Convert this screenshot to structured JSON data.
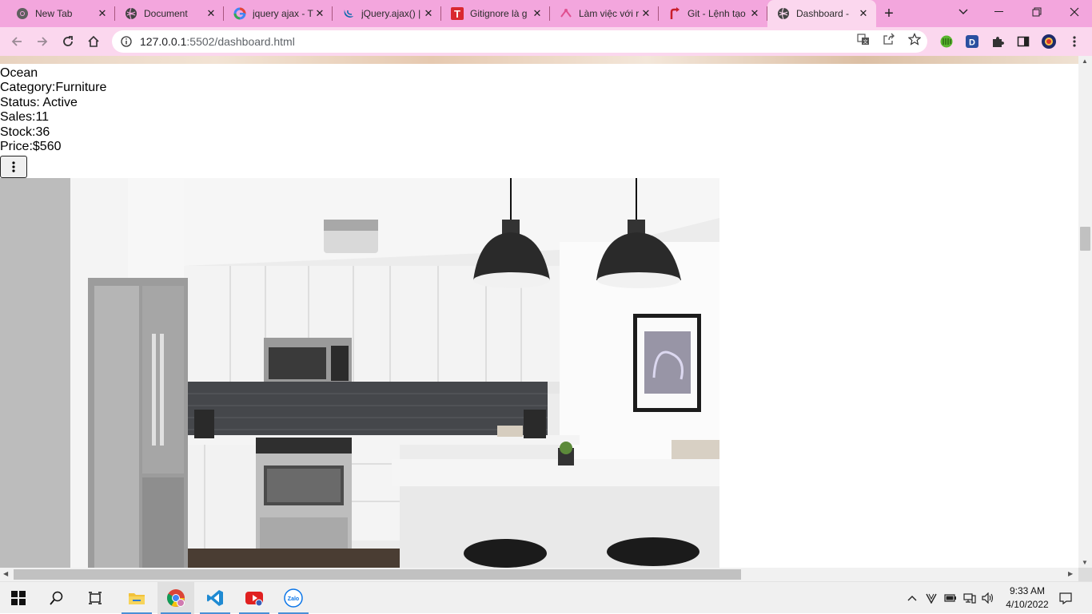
{
  "browser": {
    "tabs": [
      {
        "title": "New Tab",
        "icon": "chrome-icon"
      },
      {
        "title": "Document",
        "icon": "globe-icon"
      },
      {
        "title": "jquery ajax - T",
        "icon": "google-icon"
      },
      {
        "title": "jQuery.ajax() |",
        "icon": "jquery-icon"
      },
      {
        "title": "Gitignore là g",
        "icon": "t-logo-icon"
      },
      {
        "title": "Làm việc với r",
        "icon": "pink-arrow-icon"
      },
      {
        "title": "Git - Lệnh tạo",
        "icon": "red-arrow-icon"
      },
      {
        "title": "Dashboard - ",
        "icon": "globe-icon",
        "active": true
      }
    ],
    "url": {
      "host": "127.0.0.1",
      "rest": ":5502/dashboard.html"
    }
  },
  "product": {
    "name": "Ocean",
    "category_label": "Category:",
    "category": "Furniture",
    "status_label": "Status: ",
    "status": "Active",
    "sales_label": "Sales:",
    "sales": "11",
    "stock_label": "Stock:",
    "stock": "36",
    "price_label": "Price:",
    "price": "$560",
    "menu_icon": "kebab-icon"
  },
  "taskbar": {
    "time": "9:33 AM",
    "date": "4/10/2022",
    "zalo_label": "Zalo"
  },
  "colors": {
    "tabstrip": "#f3a6dd",
    "toolbar": "#fbd7ee",
    "accent": "#4a8fd6"
  }
}
